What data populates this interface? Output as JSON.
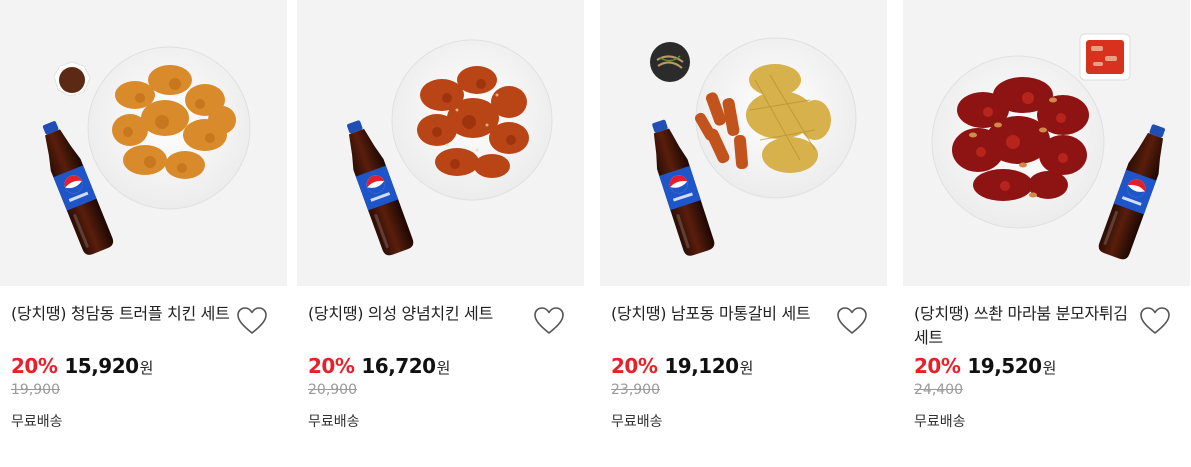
{
  "products": [
    {
      "title": "(당치땡) 청담동 트러플 치킨 세트",
      "discount": "20%",
      "price": "15,920",
      "currency": "원",
      "original_price": "19,900",
      "shipping": "무료배송",
      "image": {
        "chicken": "fried-chicken",
        "side": "truffle-sauce",
        "drink": "pepsi-bottle",
        "chicken_color": "#d98a2a"
      }
    },
    {
      "title": "(당치땡) 의성 양념치킨 세트",
      "discount": "20%",
      "price": "16,720",
      "currency": "원",
      "original_price": "20,900",
      "shipping": "무료배송",
      "image": {
        "chicken": "seasoned-chicken",
        "side": "",
        "drink": "pepsi-bottle",
        "chicken_color": "#b94416"
      }
    },
    {
      "title": "(당치땡) 남포동 마통갈비 세트",
      "discount": "20%",
      "price": "19,120",
      "currency": "원",
      "original_price": "23,900",
      "shipping": "무료배송",
      "image": {
        "chicken": "garlic-chicken-with-tteok",
        "side": "pickled-side-dish",
        "drink": "pepsi-bottle",
        "chicken_color": "#d6b14c"
      }
    },
    {
      "title": "(당치땡) 쓰촨 마라붐 분모자튀김 세트",
      "discount": "20%",
      "price": "19,520",
      "currency": "원",
      "original_price": "24,400",
      "shipping": "무료배송",
      "image": {
        "chicken": "mala-chicken",
        "side": "kimchi",
        "drink": "pepsi-bottle",
        "chicken_color": "#8e1414"
      }
    }
  ],
  "colors": {
    "discount": "#e8202a",
    "price": "#111111",
    "original_price": "#9a9a9a",
    "thumb_bg": "#f3f3f3"
  },
  "icons": {
    "wishlist": "heart-outline-icon"
  }
}
